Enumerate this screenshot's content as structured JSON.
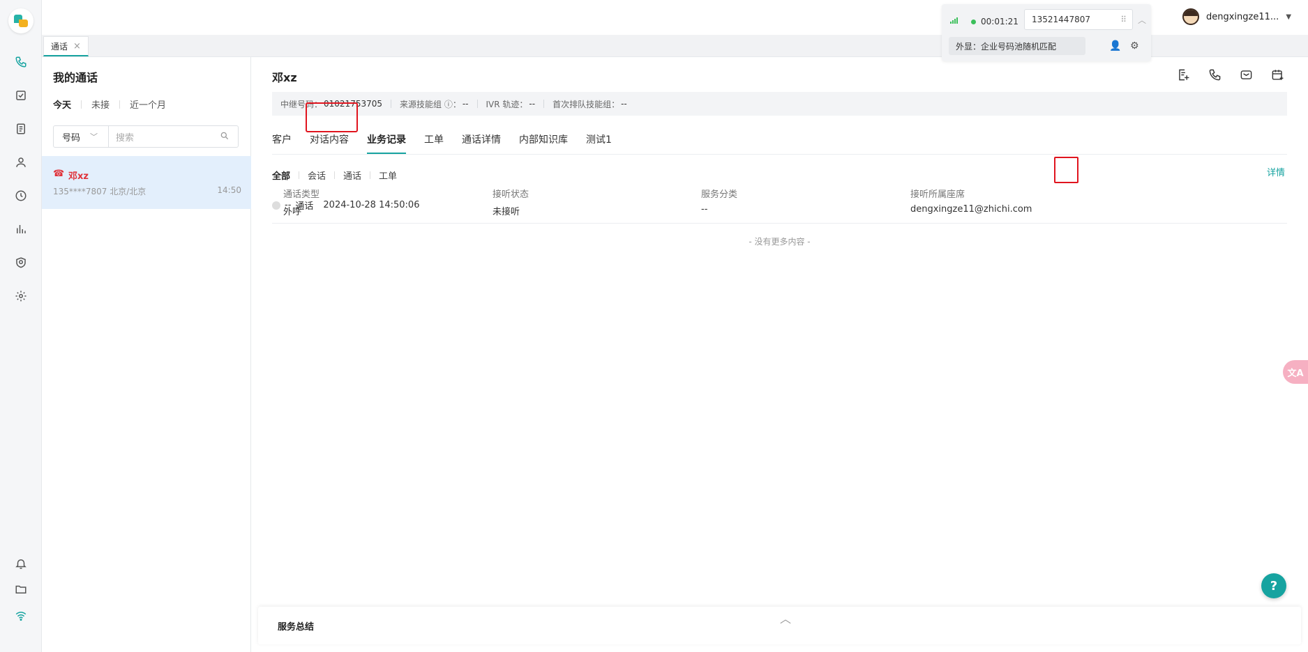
{
  "topbar": {
    "tab_label": "通话",
    "tab_close": "×",
    "call_timer": "00:01:21",
    "dial_number": "13521447807",
    "outbound_display": "外显：企业号码池随机匹配",
    "username": "dengxingze11..."
  },
  "left_rail": {
    "icons": [
      "phone-icon",
      "task-icon",
      "ticket-icon",
      "contacts-icon",
      "history-icon",
      "chart-icon",
      "shield-icon",
      "settings-icon",
      "bell-icon",
      "folder-icon",
      "wifi-icon"
    ],
    "active": "phone-icon"
  },
  "list_panel": {
    "title": "我的通话",
    "filters": [
      "今天",
      "未接",
      "近一个月"
    ],
    "search_type": "号码",
    "search_placeholder": "搜索",
    "items": [
      {
        "name": "邓xz",
        "sub": "135****7807 北京/北京",
        "time": "14:50"
      }
    ]
  },
  "main": {
    "title": "邓xz",
    "info": {
      "trunk_label": "中继号码：",
      "trunk_value": "01021753705",
      "source_label": "来源技能组 ⓘ：",
      "source_value": "--",
      "ivr_label": "IVR 轨迹：",
      "ivr_value": "--",
      "queue_label": "首次排队技能组：",
      "queue_value": "--"
    },
    "tabs": [
      "客户",
      "对话内容",
      "业务记录",
      "工单",
      "通话详情",
      "内部知识库",
      "测试1"
    ],
    "active_tab": "业务记录",
    "subtabs": [
      "全部",
      "会话",
      "通话",
      "工单"
    ],
    "record": {
      "prefix": "--",
      "type": "通话",
      "datetime": "2024-10-28 14:50:06",
      "detail_link": "详情",
      "fields": [
        {
          "label": "通话类型",
          "value": "外呼"
        },
        {
          "label": "接听状态",
          "value": "未接听"
        },
        {
          "label": "服务分类",
          "value": "--"
        },
        {
          "label": "接听所属座席",
          "value": "dengxingze11@zhichi.com"
        }
      ]
    },
    "no_more": "- 没有更多内容 -"
  },
  "summary": {
    "label": "服务总结"
  },
  "help": {
    "label": "?"
  },
  "translate": {
    "label": "文A"
  },
  "colors": {
    "accent": "#16a3a0",
    "missed": "#e0323a",
    "highlight": "#e0141e"
  }
}
